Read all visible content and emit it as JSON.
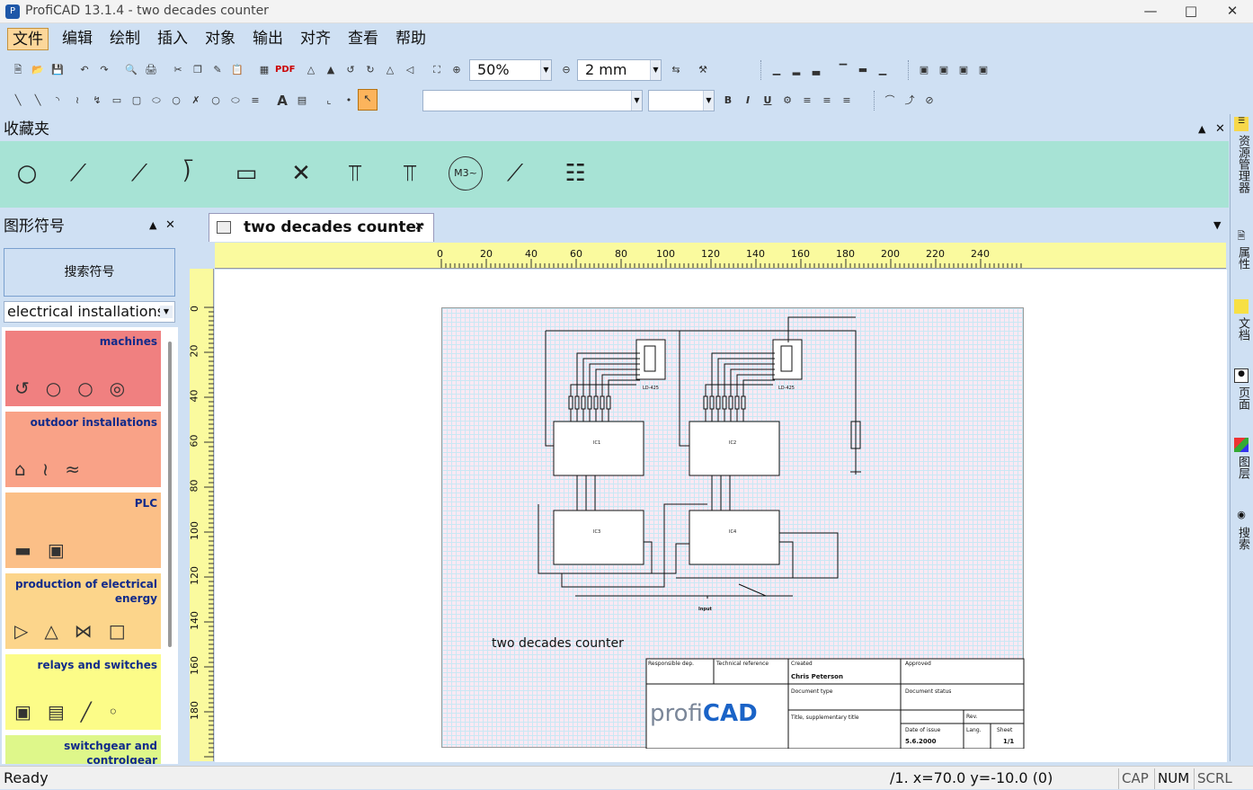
{
  "window": {
    "title": "ProfiCAD 13.1.4 - two decades counter"
  },
  "menu": [
    "文件",
    "编辑",
    "绘制",
    "插入",
    "对象",
    "输出",
    "对齐",
    "查看",
    "帮助"
  ],
  "toolbar": {
    "zoom": "50%",
    "grid": "2 mm",
    "font": "",
    "size": ""
  },
  "favorites": {
    "title": "收藏夹"
  },
  "symbols": {
    "title": "图形符号",
    "search_label": "搜索符号",
    "category": "electrical installations",
    "categories": [
      {
        "label": "machines",
        "color": "#f08080"
      },
      {
        "label": "outdoor installations",
        "color": "#f9a287"
      },
      {
        "label": "PLC",
        "color": "#fbbf87"
      },
      {
        "label": "production of electrical energy",
        "color": "#fcd58b"
      },
      {
        "label": "relays and switches",
        "color": "#fcfc88"
      },
      {
        "label": "switchgear and controlgear",
        "color": "#def78a"
      }
    ]
  },
  "document": {
    "tab": "two decades counter",
    "caption": "two decades counter",
    "ruler_h": [
      "0",
      "20",
      "40",
      "60",
      "80",
      "100",
      "120",
      "140",
      "160",
      "180",
      "200",
      "220",
      "240"
    ],
    "ruler_v": [
      "0",
      "20",
      "40",
      "60",
      "80",
      "100",
      "120",
      "140",
      "160",
      "180"
    ],
    "ic_labels": {
      "d1": "LD-425",
      "d2": "LD-425",
      "ic1": "IC1",
      "ic2": "IC2",
      "ic3": "IC3",
      "ic4": "IC4",
      "input": "Input"
    },
    "title_block": {
      "responsible": "Responsible dep.",
      "tech_ref": "Technical reference",
      "created": "Created",
      "approved": "Approved",
      "author": "Chris Peterson",
      "doc_type": "Document type",
      "doc_status": "Document status",
      "title_sup": "Title, supplementary title",
      "rev": "Rev.",
      "date_issue": "Date of issue",
      "lang": "Lang.",
      "sheet": "Sheet",
      "date": "5.6.2000",
      "sheet_val": "1/1",
      "logo_a": "profi",
      "logo_b": "CAD"
    }
  },
  "right_tabs": [
    "资源管理器",
    "属性",
    "文档",
    "页面",
    "图层",
    "搜索"
  ],
  "status": {
    "ready": "Ready",
    "coords": "/1.  x=70.0  y=-10.0 (0)",
    "cap": "CAP",
    "num": "NUM",
    "scrl": "SCRL"
  }
}
